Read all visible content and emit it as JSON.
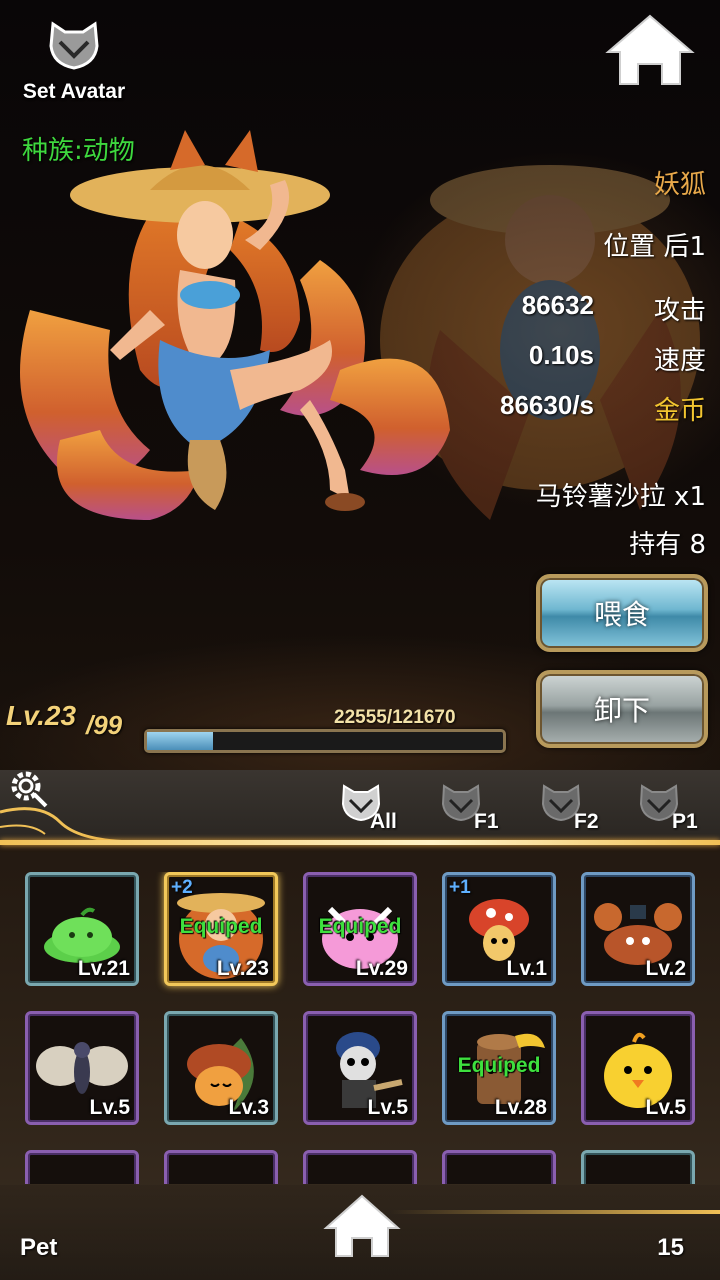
{
  "header": {
    "set_avatar_label": "Set Avatar",
    "race_label": "种族:动物"
  },
  "pet": {
    "name": "妖狐",
    "position_label": "位置 后1",
    "stats": [
      {
        "value": "86632",
        "label": "攻击"
      },
      {
        "value": "0.10s",
        "label": "速度"
      },
      {
        "value": "86630/s",
        "label": "金币"
      }
    ],
    "food": "马铃薯沙拉 x1",
    "owned": "持有 8",
    "feed_button": "喂食",
    "unload_button": "卸下",
    "level_current": "Lv.23",
    "level_max": "/99",
    "exp_text": "22555/121670",
    "exp_fraction": 0.185
  },
  "filters": [
    {
      "label": "All"
    },
    {
      "label": "F1"
    },
    {
      "label": "F2"
    },
    {
      "label": "P1"
    }
  ],
  "pets_grid": [
    {
      "level": "Lv.21",
      "plus": "",
      "equipped": "",
      "frame": "teal",
      "art": "slime-icon"
    },
    {
      "level": "Lv.23",
      "plus": "+2",
      "equipped": "Equiped",
      "frame": "selected",
      "art": "fox-girl-icon"
    },
    {
      "level": "Lv.29",
      "plus": "",
      "equipped": "Equiped",
      "frame": "purple",
      "art": "pink-blob-icon"
    },
    {
      "level": "Lv.1",
      "plus": "+1",
      "equipped": "",
      "frame": "blue",
      "art": "mushroom-icon"
    },
    {
      "level": "Lv.2",
      "plus": "",
      "equipped": "",
      "frame": "blue",
      "art": "crab-icon"
    },
    {
      "level": "Lv.5",
      "plus": "",
      "equipped": "",
      "frame": "purple",
      "art": "moth-icon"
    },
    {
      "level": "Lv.3",
      "plus": "",
      "equipped": "",
      "frame": "teal",
      "art": "mushroom-leaf-icon"
    },
    {
      "level": "Lv.5",
      "plus": "",
      "equipped": "",
      "frame": "purple",
      "art": "skull-miner-icon"
    },
    {
      "level": "Lv.28",
      "plus": "",
      "equipped": "Equiped",
      "frame": "blue",
      "art": "wood-stump-icon"
    },
    {
      "level": "Lv.5",
      "plus": "",
      "equipped": "",
      "frame": "purple",
      "art": "chick-icon"
    },
    {
      "level": "",
      "plus": "",
      "equipped": "",
      "frame": "purple",
      "art": "hidden"
    },
    {
      "level": "",
      "plus": "",
      "equipped": "",
      "frame": "purple",
      "art": "hidden"
    },
    {
      "level": "",
      "plus": "",
      "equipped": "",
      "frame": "purple",
      "art": "hidden"
    },
    {
      "level": "",
      "plus": "",
      "equipped": "",
      "frame": "purple",
      "art": "hidden"
    },
    {
      "level": "",
      "plus": "",
      "equipped": "",
      "frame": "teal",
      "art": "hidden"
    }
  ],
  "footer": {
    "tab_label": "Pet",
    "count": "15"
  },
  "colors": {
    "race_green": "#3ed83e",
    "name_orange": "#e8a84a",
    "gold_label": "#f2c530",
    "equip_green": "#3ee03e",
    "accent_gold": "#f0c056"
  }
}
